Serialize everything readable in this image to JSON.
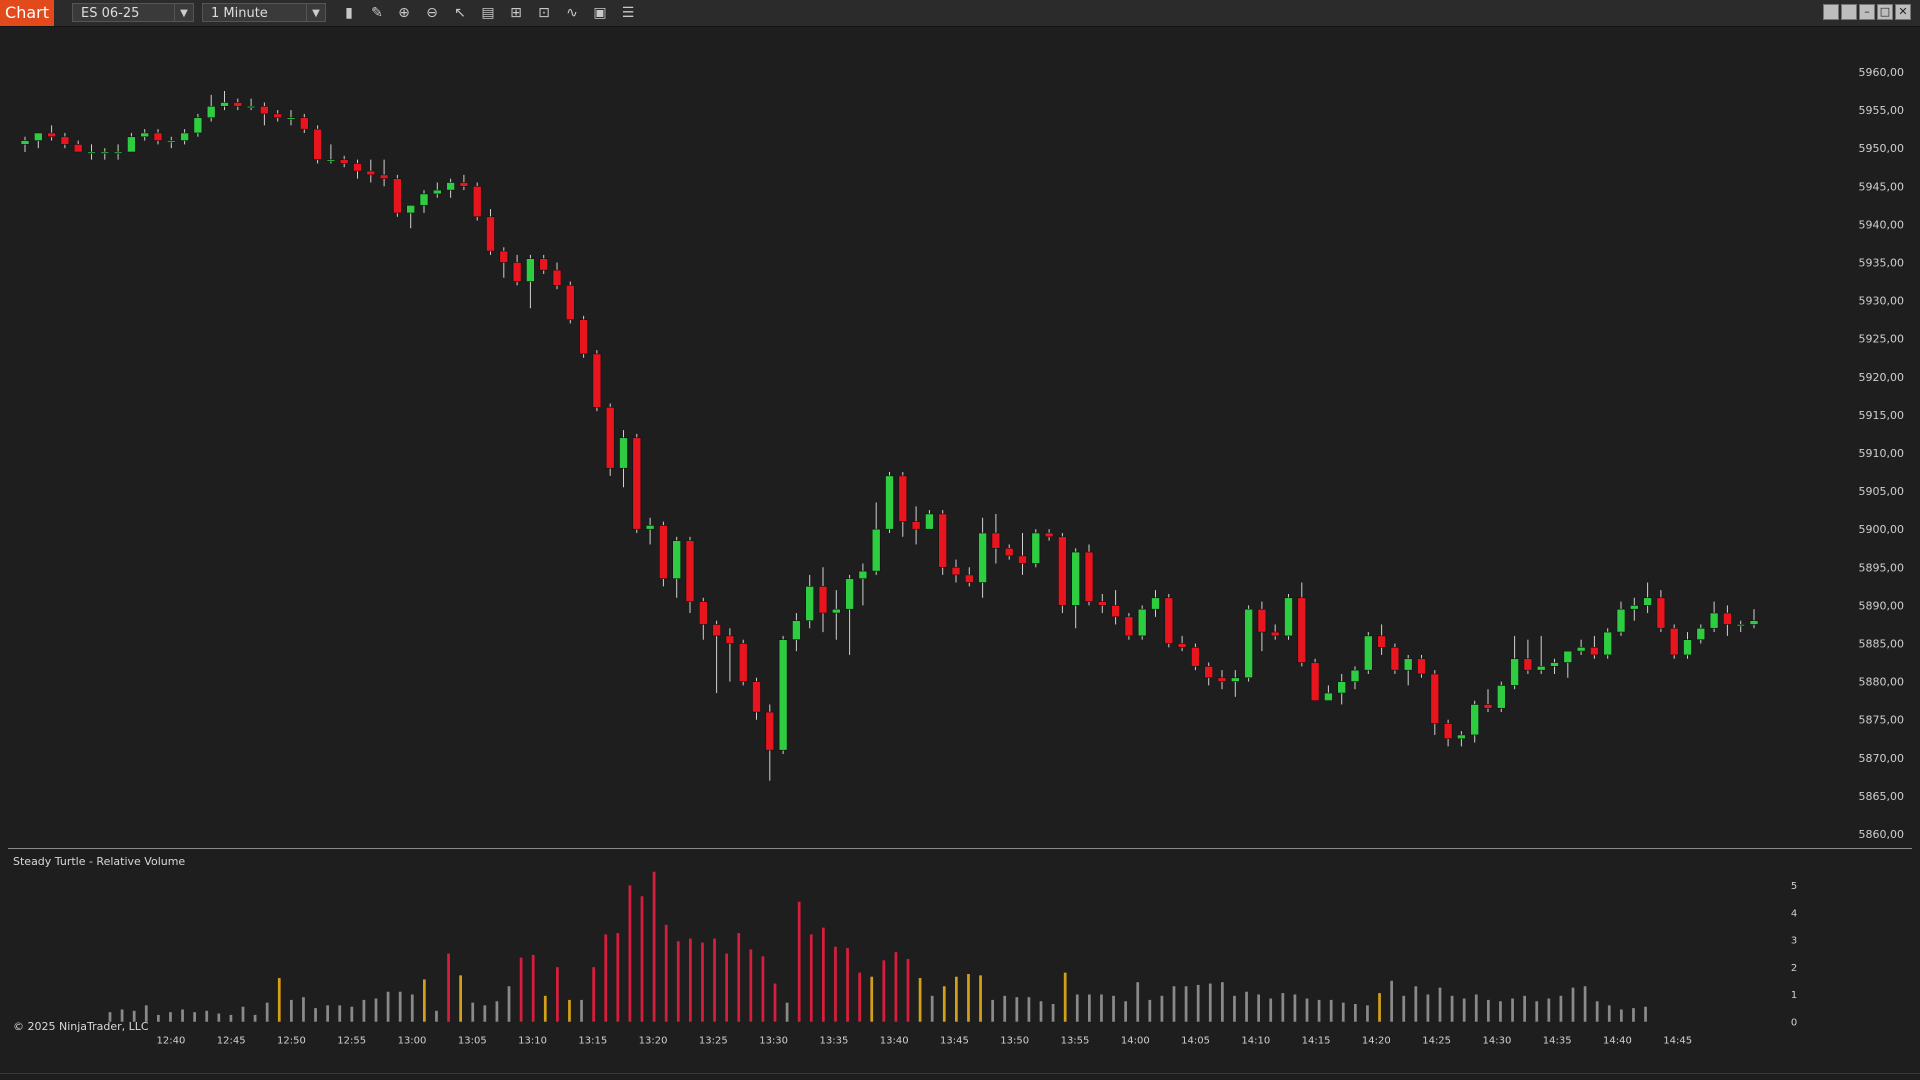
{
  "toolbar": {
    "tab_label": "Chart",
    "instrument": "ES 06-25",
    "interval": "1 Minute",
    "icons": [
      "bar-type-icon",
      "drawing-pencil-icon",
      "zoom-in-icon",
      "zoom-out-icon",
      "pointer-icon",
      "properties-icon",
      "templates-icon",
      "strategy-icon",
      "indicators-icon",
      "data-box-icon",
      "list-icon"
    ]
  },
  "window_controls": [
    "restore-icon",
    "tile-icon",
    "minimize-icon",
    "maximize-icon",
    "close-icon"
  ],
  "indicator_label": "Steady Turtle - Relative Volume",
  "copyright": "© 2025 NinjaTrader, LLC",
  "colors": {
    "up": "#2ecc40",
    "down": "#e8141e",
    "vol_gray": "#8a8a8a",
    "vol_orange": "#d4a017",
    "vol_red": "#d81e3c"
  },
  "chart_data": [
    {
      "type": "candlestick",
      "ylim": [
        5858,
        5963
      ],
      "y_ticks": [
        "5960,00",
        "5955,00",
        "5950,00",
        "5945,00",
        "5940,00",
        "5935,00",
        "5930,00",
        "5925,00",
        "5920,00",
        "5915,00",
        "5910,00",
        "5905,00",
        "5900,00",
        "5895,00",
        "5890,00",
        "5885,00",
        "5880,00",
        "5875,00",
        "5870,00",
        "5865,00",
        "5860,00"
      ],
      "x_ticks": [
        "12:40",
        "12:45",
        "12:50",
        "12:55",
        "13:00",
        "13:05",
        "13:10",
        "13:15",
        "13:20",
        "13:25",
        "13:30",
        "13:35",
        "13:40",
        "13:45",
        "13:50",
        "13:55",
        "14:00",
        "14:05",
        "14:10",
        "14:15",
        "14:20",
        "14:25",
        "14:30",
        "14:35",
        "14:40",
        "14:45"
      ],
      "first_bar_time": "12:39",
      "candles": [
        [
          5950.5,
          5951.5,
          5949.5,
          5951.0
        ],
        [
          5951.0,
          5952.0,
          5950.0,
          5952.0
        ],
        [
          5952.0,
          5953.0,
          5951.0,
          5951.5
        ],
        [
          5951.5,
          5952.0,
          5950.0,
          5950.5
        ],
        [
          5950.5,
          5951.0,
          5949.5,
          5949.5
        ],
        [
          5949.5,
          5950.5,
          5948.5,
          5949.5
        ],
        [
          5949.5,
          5950.0,
          5948.5,
          5949.5
        ],
        [
          5949.5,
          5950.5,
          5948.5,
          5949.5
        ],
        [
          5949.5,
          5952.0,
          5949.5,
          5951.5
        ],
        [
          5951.5,
          5952.5,
          5951.0,
          5952.0
        ],
        [
          5952.0,
          5952.5,
          5950.5,
          5951.0
        ],
        [
          5951.0,
          5951.5,
          5950.0,
          5951.0
        ],
        [
          5951.0,
          5952.5,
          5950.5,
          5952.0
        ],
        [
          5952.0,
          5954.5,
          5951.5,
          5954.0
        ],
        [
          5954.0,
          5957.0,
          5953.5,
          5955.5
        ],
        [
          5955.5,
          5957.5,
          5955.0,
          5956.0
        ],
        [
          5956.0,
          5956.5,
          5955.0,
          5955.5
        ],
        [
          5955.5,
          5956.5,
          5955.0,
          5955.5
        ],
        [
          5955.5,
          5956.0,
          5953.0,
          5954.5
        ],
        [
          5954.5,
          5955.0,
          5953.5,
          5954.0
        ],
        [
          5954.0,
          5955.0,
          5953.0,
          5954.0
        ],
        [
          5954.0,
          5954.5,
          5952.0,
          5952.5
        ],
        [
          5952.5,
          5953.0,
          5948.0,
          5948.5
        ],
        [
          5948.5,
          5950.5,
          5948.0,
          5948.5
        ],
        [
          5948.5,
          5949.0,
          5947.5,
          5948.0
        ],
        [
          5948.0,
          5948.5,
          5946.0,
          5947.0
        ],
        [
          5947.0,
          5948.5,
          5945.5,
          5946.5
        ],
        [
          5946.5,
          5948.5,
          5945.0,
          5946.0
        ],
        [
          5946.0,
          5946.5,
          5941.0,
          5941.5
        ],
        [
          5941.5,
          5942.5,
          5939.5,
          5942.5
        ],
        [
          5942.5,
          5944.5,
          5941.5,
          5944.0
        ],
        [
          5944.0,
          5945.5,
          5943.5,
          5944.5
        ],
        [
          5944.5,
          5946.0,
          5943.5,
          5945.5
        ],
        [
          5945.5,
          5946.5,
          5944.5,
          5945.0
        ],
        [
          5945.0,
          5945.5,
          5940.5,
          5941.0
        ],
        [
          5941.0,
          5942.0,
          5936.0,
          5936.5
        ],
        [
          5936.5,
          5937.0,
          5933.0,
          5935.0
        ],
        [
          5935.0,
          5936.0,
          5932.0,
          5932.5
        ],
        [
          5932.5,
          5936.0,
          5929.0,
          5935.5
        ],
        [
          5935.5,
          5936.0,
          5933.5,
          5934.0
        ],
        [
          5934.0,
          5935.0,
          5931.5,
          5932.0
        ],
        [
          5932.0,
          5932.5,
          5927.0,
          5927.5
        ],
        [
          5927.5,
          5928.0,
          5922.5,
          5923.0
        ],
        [
          5923.0,
          5923.5,
          5915.5,
          5916.0
        ],
        [
          5916.0,
          5916.5,
          5907.0,
          5908.0
        ],
        [
          5908.0,
          5913.0,
          5905.5,
          5912.0
        ],
        [
          5912.0,
          5912.5,
          5899.5,
          5900.0
        ],
        [
          5900.0,
          5901.5,
          5898.0,
          5900.5
        ],
        [
          5900.5,
          5901.0,
          5892.5,
          5893.5
        ],
        [
          5893.5,
          5899.0,
          5891.0,
          5898.5
        ],
        [
          5898.5,
          5899.0,
          5889.0,
          5890.5
        ],
        [
          5890.5,
          5891.0,
          5885.5,
          5887.5
        ],
        [
          5887.5,
          5888.0,
          5878.5,
          5886.0
        ],
        [
          5886.0,
          5887.0,
          5880.0,
          5885.0
        ],
        [
          5885.0,
          5885.5,
          5879.5,
          5880.0
        ],
        [
          5880.0,
          5880.5,
          5875.0,
          5876.0
        ],
        [
          5876.0,
          5877.0,
          5867.0,
          5871.0
        ],
        [
          5871.0,
          5886.0,
          5870.5,
          5885.5
        ],
        [
          5885.5,
          5889.0,
          5884.0,
          5888.0
        ],
        [
          5888.0,
          5894.0,
          5887.0,
          5892.5
        ],
        [
          5892.5,
          5895.0,
          5886.5,
          5889.0
        ],
        [
          5889.0,
          5892.0,
          5885.5,
          5889.5
        ],
        [
          5889.5,
          5894.0,
          5883.5,
          5893.5
        ],
        [
          5893.5,
          5895.5,
          5890.0,
          5894.5
        ],
        [
          5894.5,
          5903.5,
          5894.0,
          5900.0
        ],
        [
          5900.0,
          5907.5,
          5899.5,
          5907.0
        ],
        [
          5907.0,
          5907.5,
          5899.0,
          5901.0
        ],
        [
          5901.0,
          5903.0,
          5898.0,
          5900.0
        ],
        [
          5900.0,
          5902.5,
          5900.0,
          5902.0
        ],
        [
          5902.0,
          5902.5,
          5894.0,
          5895.0
        ],
        [
          5895.0,
          5896.0,
          5893.0,
          5894.0
        ],
        [
          5894.0,
          5895.0,
          5892.5,
          5893.0
        ],
        [
          5893.0,
          5901.5,
          5891.0,
          5899.5
        ],
        [
          5899.5,
          5902.0,
          5895.5,
          5897.5
        ],
        [
          5897.5,
          5898.0,
          5896.0,
          5896.5
        ],
        [
          5896.5,
          5899.5,
          5894.0,
          5895.5
        ],
        [
          5895.5,
          5900.0,
          5895.0,
          5899.5
        ],
        [
          5899.5,
          5900.0,
          5898.5,
          5899.0
        ],
        [
          5899.0,
          5899.5,
          5889.0,
          5890.0
        ],
        [
          5890.0,
          5897.5,
          5887.0,
          5897.0
        ],
        [
          5897.0,
          5898.0,
          5890.0,
          5890.5
        ],
        [
          5890.5,
          5891.5,
          5889.0,
          5890.0
        ],
        [
          5890.0,
          5892.0,
          5887.5,
          5888.5
        ],
        [
          5888.5,
          5889.0,
          5885.5,
          5886.0
        ],
        [
          5886.0,
          5890.0,
          5885.5,
          5889.5
        ],
        [
          5889.5,
          5892.0,
          5888.5,
          5891.0
        ],
        [
          5891.0,
          5891.5,
          5884.5,
          5885.0
        ],
        [
          5885.0,
          5886.0,
          5884.0,
          5884.5
        ],
        [
          5884.5,
          5885.0,
          5881.5,
          5882.0
        ],
        [
          5882.0,
          5882.5,
          5879.5,
          5880.5
        ],
        [
          5880.5,
          5881.5,
          5879.0,
          5880.0
        ],
        [
          5880.0,
          5881.5,
          5878.0,
          5880.5
        ],
        [
          5880.5,
          5890.0,
          5880.0,
          5889.5
        ],
        [
          5889.5,
          5890.5,
          5884.0,
          5886.5
        ],
        [
          5886.5,
          5887.5,
          5885.5,
          5886.0
        ],
        [
          5886.0,
          5891.5,
          5885.5,
          5891.0
        ],
        [
          5891.0,
          5893.0,
          5882.0,
          5882.5
        ],
        [
          5882.5,
          5883.0,
          5877.5,
          5877.5
        ],
        [
          5877.5,
          5879.5,
          5877.5,
          5878.5
        ],
        [
          5878.5,
          5881.0,
          5877.0,
          5880.0
        ],
        [
          5880.0,
          5882.0,
          5879.0,
          5881.5
        ],
        [
          5881.5,
          5886.5,
          5881.0,
          5886.0
        ],
        [
          5886.0,
          5887.5,
          5883.5,
          5884.5
        ],
        [
          5884.5,
          5885.0,
          5881.0,
          5881.5
        ],
        [
          5881.5,
          5883.5,
          5879.5,
          5883.0
        ],
        [
          5883.0,
          5883.5,
          5880.5,
          5881.0
        ],
        [
          5881.0,
          5881.5,
          5873.0,
          5874.5
        ],
        [
          5874.5,
          5875.0,
          5871.5,
          5872.5
        ],
        [
          5872.5,
          5873.5,
          5871.5,
          5873.0
        ],
        [
          5873.0,
          5877.5,
          5872.0,
          5877.0
        ],
        [
          5877.0,
          5879.0,
          5876.0,
          5876.5
        ],
        [
          5876.5,
          5880.0,
          5876.0,
          5879.5
        ],
        [
          5879.5,
          5886.0,
          5879.0,
          5883.0
        ],
        [
          5883.0,
          5885.5,
          5881.0,
          5881.5
        ],
        [
          5881.5,
          5886.0,
          5881.0,
          5882.0
        ],
        [
          5882.0,
          5883.0,
          5881.0,
          5882.5
        ],
        [
          5882.5,
          5884.0,
          5880.5,
          5884.0
        ],
        [
          5884.0,
          5885.5,
          5883.5,
          5884.5
        ],
        [
          5884.5,
          5886.0,
          5883.0,
          5883.5
        ],
        [
          5883.5,
          5887.0,
          5883.0,
          5886.5
        ],
        [
          5886.5,
          5890.5,
          5886.0,
          5889.5
        ],
        [
          5889.5,
          5891.0,
          5888.0,
          5890.0
        ],
        [
          5890.0,
          5893.0,
          5889.0,
          5891.0
        ],
        [
          5891.0,
          5892.0,
          5886.5,
          5887.0
        ],
        [
          5887.0,
          5887.5,
          5883.0,
          5883.5
        ],
        [
          5883.5,
          5886.5,
          5883.0,
          5885.5
        ],
        [
          5885.5,
          5887.5,
          5885.0,
          5887.0
        ],
        [
          5887.0,
          5890.5,
          5886.5,
          5889.0
        ],
        [
          5889.0,
          5890.0,
          5886.0,
          5887.5
        ],
        [
          5887.5,
          5888.0,
          5886.5,
          5887.5
        ],
        [
          5887.5,
          5889.5,
          5887.0,
          5888.0
        ]
      ]
    },
    {
      "type": "bar",
      "title": "Steady Turtle - Relative Volume",
      "ylim": [
        0,
        5.5
      ],
      "y_ticks": [
        "5",
        "4",
        "3",
        "2",
        "1",
        "0"
      ],
      "values": [
        0.35,
        0.45,
        0.4,
        0.6,
        0.25,
        0.35,
        0.45,
        0.35,
        0.4,
        0.3,
        0.25,
        0.55,
        0.25,
        0.7,
        1.6,
        0.8,
        0.9,
        0.5,
        0.6,
        0.6,
        0.55,
        0.8,
        0.85,
        1.1,
        1.1,
        1.0,
        1.55,
        0.4,
        2.5,
        1.7,
        0.7,
        0.6,
        0.75,
        1.3,
        2.35,
        2.45,
        0.95,
        2.0,
        0.8,
        0.8,
        2.0,
        3.2,
        3.25,
        5.0,
        4.6,
        5.5,
        3.55,
        2.95,
        3.05,
        2.9,
        3.05,
        2.5,
        3.25,
        2.65,
        2.4,
        1.4,
        0.7,
        4.4,
        3.2,
        3.45,
        2.75,
        2.7,
        1.8,
        1.65,
        2.25,
        2.55,
        2.3,
        1.6,
        0.95,
        1.3,
        1.65,
        1.75,
        1.7,
        0.8,
        0.95,
        0.9,
        0.9,
        0.75,
        0.65,
        1.8,
        1.0,
        1.0,
        1.0,
        0.95,
        0.75,
        1.45,
        0.8,
        0.95,
        1.3,
        1.3,
        1.35,
        1.4,
        1.45,
        0.95,
        1.1,
        1.0,
        0.85,
        1.05,
        1.0,
        0.85,
        0.8,
        0.8,
        0.7,
        0.65,
        0.6,
        1.05,
        1.5,
        0.95,
        1.3,
        1.0,
        1.25,
        0.95,
        0.85,
        1.0,
        0.8,
        0.75,
        0.85,
        0.95,
        0.75,
        0.85,
        0.95,
        1.25,
        1.3,
        0.75,
        0.6,
        0.45,
        0.5,
        0.55
      ],
      "colors": [
        "g",
        "g",
        "g",
        "g",
        "g",
        "g",
        "g",
        "g",
        "g",
        "g",
        "g",
        "g",
        "g",
        "g",
        "o",
        "g",
        "g",
        "g",
        "g",
        "g",
        "g",
        "g",
        "g",
        "g",
        "g",
        "g",
        "o",
        "g",
        "r",
        "o",
        "g",
        "g",
        "g",
        "g",
        "r",
        "r",
        "o",
        "r",
        "o",
        "g",
        "r",
        "r",
        "r",
        "r",
        "r",
        "r",
        "r",
        "r",
        "r",
        "r",
        "r",
        "r",
        "r",
        "r",
        "r",
        "r",
        "g",
        "r",
        "r",
        "r",
        "r",
        "r",
        "r",
        "o",
        "r",
        "r",
        "r",
        "o",
        "g",
        "o",
        "o",
        "o",
        "o",
        "g",
        "g",
        "g",
        "g",
        "g",
        "g",
        "o",
        "g",
        "g",
        "g",
        "g",
        "g",
        "g",
        "g",
        "g",
        "g",
        "g",
        "g",
        "g",
        "g",
        "g",
        "g",
        "g",
        "g",
        "g",
        "g",
        "g",
        "g",
        "g",
        "g",
        "g",
        "g",
        "o",
        "g",
        "g",
        "g",
        "g",
        "g",
        "g",
        "g",
        "g",
        "g",
        "g",
        "g",
        "g",
        "g",
        "g",
        "g",
        "g",
        "g",
        "g",
        "g",
        "g",
        "g",
        "g"
      ]
    }
  ]
}
